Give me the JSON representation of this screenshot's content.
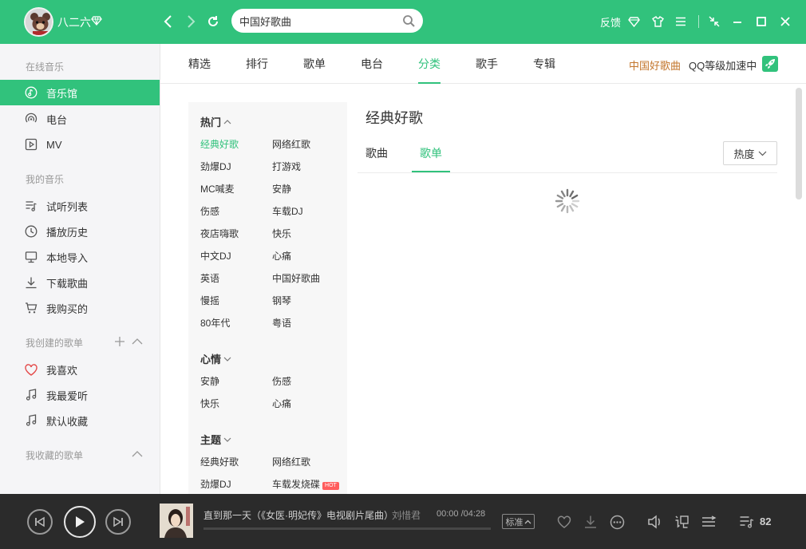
{
  "user": {
    "name": "八二六"
  },
  "search": {
    "value": "中国好歌曲",
    "placeholder": ""
  },
  "header": {
    "feedback_label": "反馈"
  },
  "sidebar": {
    "online_title": "在线音乐",
    "online_items": [
      {
        "label": "音乐馆",
        "icon": "music-hall-icon",
        "active": true
      },
      {
        "label": "电台",
        "icon": "radio-icon"
      },
      {
        "label": "MV",
        "icon": "mv-icon"
      }
    ],
    "my_title": "我的音乐",
    "my_items": [
      {
        "label": "试听列表",
        "icon": "playlist-icon"
      },
      {
        "label": "播放历史",
        "icon": "history-icon"
      },
      {
        "label": "本地导入",
        "icon": "local-import-icon"
      },
      {
        "label": "下载歌曲",
        "icon": "download-icon"
      },
      {
        "label": "我购买的",
        "icon": "cart-icon"
      }
    ],
    "created_title": "我创建的歌单",
    "created_items": [
      {
        "label": "我喜欢",
        "icon": "heart-icon"
      },
      {
        "label": "我最爱听",
        "icon": "note-icon"
      },
      {
        "label": "默认收藏",
        "icon": "note-icon"
      }
    ],
    "collected_title": "我收藏的歌单"
  },
  "tabs": {
    "items": [
      "精选",
      "排行",
      "歌单",
      "电台",
      "分类",
      "歌手",
      "专辑"
    ],
    "active": "分类",
    "promo_label": "中国好歌曲",
    "speed_label": "QQ等级加速中"
  },
  "categories": {
    "groups": [
      {
        "title": "热门",
        "items": [
          "经典好歌",
          "网络红歌",
          "劲爆DJ",
          "打游戏",
          "MC喊麦",
          "安静",
          "伤感",
          "车载DJ",
          "夜店嗨歌",
          "快乐",
          "中文DJ",
          "心痛",
          "英语",
          "中国好歌曲",
          "慢摇",
          "钢琴",
          "80年代",
          "粤语"
        ]
      },
      {
        "title": "心情",
        "items": [
          "安静",
          "伤感",
          "快乐",
          "心痛"
        ]
      },
      {
        "title": "主题",
        "items": [
          "经典好歌",
          "网络红歌",
          "劲爆DJ",
          "车载发烧碟"
        ]
      }
    ],
    "hot_badge": "HOT"
  },
  "content": {
    "title": "经典好歌",
    "subtabs": [
      "歌曲",
      "歌单"
    ],
    "active_subtab": "歌单",
    "sort_label": "热度"
  },
  "player": {
    "song_title": "直到那一天（《女医·明妃传》电视剧片尾曲）",
    "separator": "-",
    "artist": "刘惜君",
    "time_current": "00:00",
    "time_total": "/04:28",
    "quality_label": "标准",
    "playlist_count": "82",
    "progress": 0
  },
  "colors": {
    "accent": "#31c27c",
    "player_bg": "#2b2b2b",
    "promo": "#c3752b",
    "hot": "#ff5d5d"
  }
}
